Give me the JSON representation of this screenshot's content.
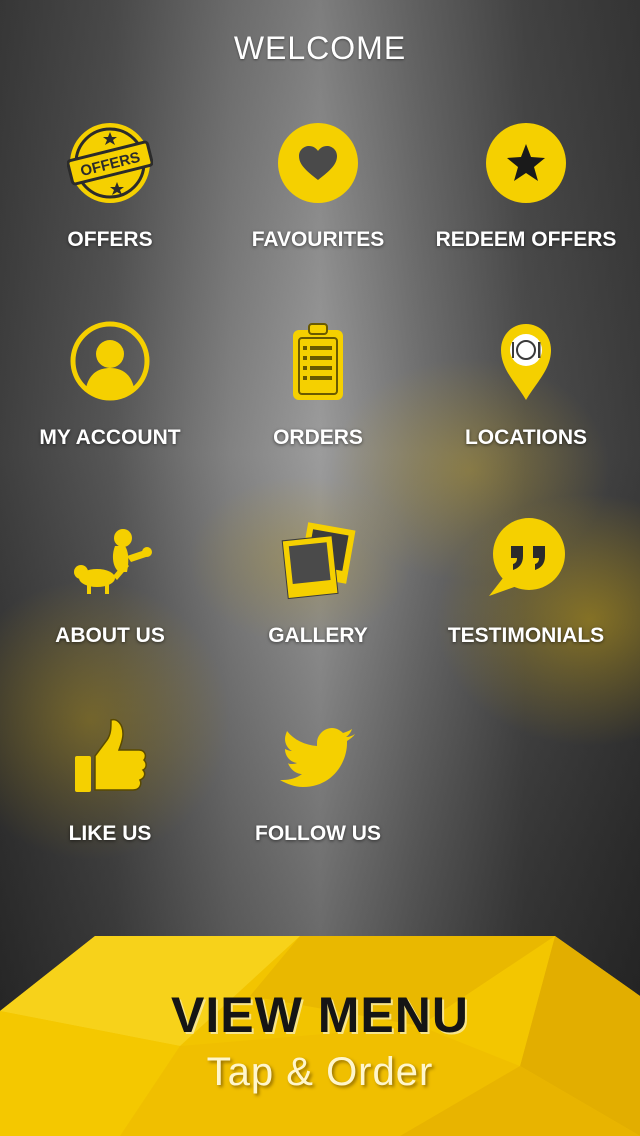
{
  "header": {
    "title": "WELCOME"
  },
  "menu": [
    {
      "label": "OFFERS",
      "icon": "offers-badge-icon",
      "badge_text": "OFFERS"
    },
    {
      "label": "FAVOURITES",
      "icon": "heart-icon"
    },
    {
      "label": "REDEEM OFFERS",
      "icon": "star-icon"
    },
    {
      "label": "MY ACCOUNT",
      "icon": "user-icon"
    },
    {
      "label": "ORDERS",
      "icon": "clipboard-icon"
    },
    {
      "label": "LOCATIONS",
      "icon": "map-pin-icon"
    },
    {
      "label": "ABOUT US",
      "icon": "dog-icon"
    },
    {
      "label": "GALLERY",
      "icon": "photos-icon"
    },
    {
      "label": "TESTIMONIALS",
      "icon": "quote-bubble-icon"
    },
    {
      "label": "LIKE US",
      "icon": "thumbs-up-icon"
    },
    {
      "label": "FOLLOW US",
      "icon": "twitter-bird-icon"
    }
  ],
  "cta": {
    "title": "VIEW MENU",
    "subtitle": "Tap & Order"
  },
  "colors": {
    "accent": "#F5D000",
    "dark": "#151515",
    "text": "#FFFFFF"
  }
}
